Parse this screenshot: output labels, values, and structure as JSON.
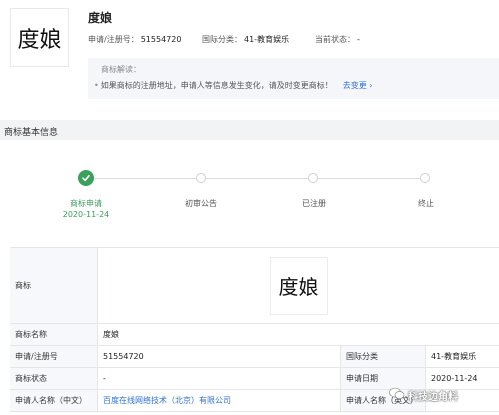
{
  "header": {
    "logo_text": "度娘",
    "name": "度娘",
    "reg_no_label": "申请/注册号：",
    "reg_no": "51554720",
    "class_label": "国际分类：",
    "class_value": "41-教育娱乐",
    "status_label": "当前状态：",
    "status_value": "-"
  },
  "notice": {
    "title": "商标解读：",
    "text": "如果商标的注册地址，申请人等信息发生变化，请及时变更商标！",
    "link": "去变更"
  },
  "section": {
    "title": "商标基本信息"
  },
  "timeline": {
    "steps": [
      {
        "label": "商标申请",
        "date": "2020-11-24",
        "done": true
      },
      {
        "label": "初审公告",
        "date": "",
        "done": false
      },
      {
        "label": "已注册",
        "date": "",
        "done": false
      },
      {
        "label": "终止",
        "date": "",
        "done": false
      }
    ]
  },
  "table": {
    "row_mark": {
      "key": "商标",
      "image_text": "度娘"
    },
    "row_name": {
      "key": "商标名称",
      "value": "度娘"
    },
    "row_reg": {
      "key": "申请/注册号",
      "value": "51554720",
      "key2": "国际分类",
      "value2": "41-教育娱乐"
    },
    "row_status": {
      "key": "商标状态",
      "value": "-",
      "key2": "申请日期",
      "value2": "2020-11-24"
    },
    "row_applicant": {
      "key": "申请人名称（中文）",
      "value": "百度在线网络技术（北京）有限公司",
      "key2": "申请人名称（英文）",
      "value2": "-"
    }
  },
  "watermark": "科技边角料"
}
